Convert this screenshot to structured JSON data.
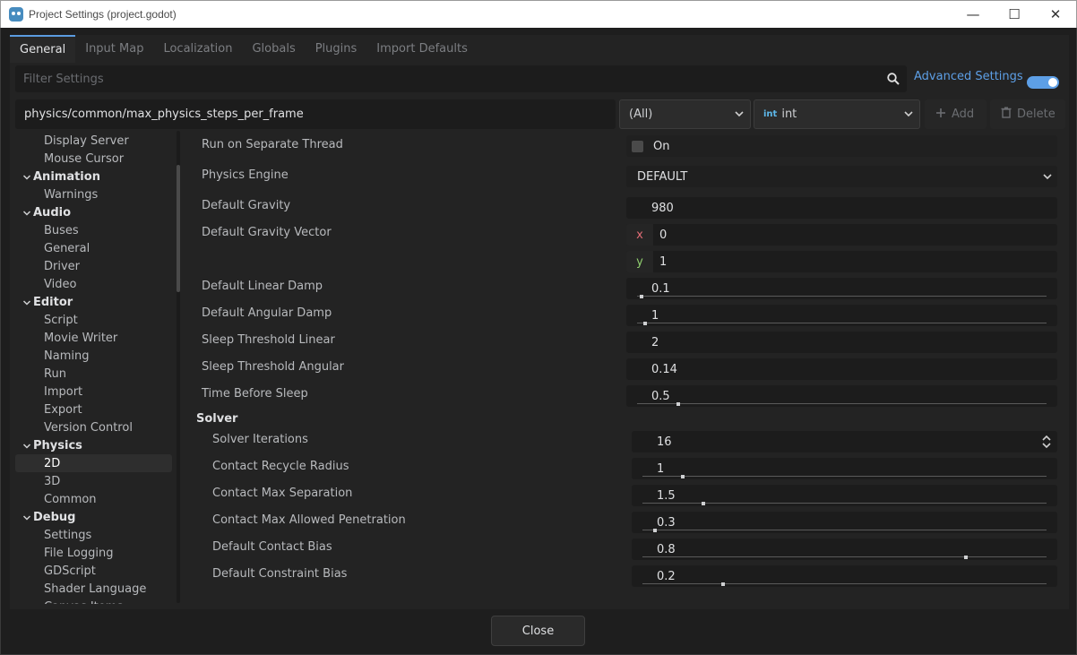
{
  "window": {
    "title": "Project Settings (project.godot)"
  },
  "tabs": [
    "General",
    "Input Map",
    "Localization",
    "Globals",
    "Plugins",
    "Import Defaults"
  ],
  "search": {
    "placeholder": "Filter Settings",
    "advanced_label": "Advanced Settings",
    "advanced_enabled": true
  },
  "path_bar": {
    "path": "physics/common/max_physics_steps_per_frame",
    "filter_value": "(All)",
    "type_icon": "int",
    "type_value": "int",
    "add_label": "Add",
    "delete_label": "Delete"
  },
  "tree": [
    {
      "label": "Display Server",
      "kind": "item"
    },
    {
      "label": "Mouse Cursor",
      "kind": "item"
    },
    {
      "label": "Animation",
      "kind": "cat"
    },
    {
      "label": "Warnings",
      "kind": "item"
    },
    {
      "label": "Audio",
      "kind": "cat"
    },
    {
      "label": "Buses",
      "kind": "item"
    },
    {
      "label": "General",
      "kind": "item"
    },
    {
      "label": "Driver",
      "kind": "item"
    },
    {
      "label": "Video",
      "kind": "item"
    },
    {
      "label": "Editor",
      "kind": "cat"
    },
    {
      "label": "Script",
      "kind": "item"
    },
    {
      "label": "Movie Writer",
      "kind": "item"
    },
    {
      "label": "Naming",
      "kind": "item"
    },
    {
      "label": "Run",
      "kind": "item"
    },
    {
      "label": "Import",
      "kind": "item"
    },
    {
      "label": "Export",
      "kind": "item"
    },
    {
      "label": "Version Control",
      "kind": "item"
    },
    {
      "label": "Physics",
      "kind": "cat"
    },
    {
      "label": "2D",
      "kind": "item",
      "selected": true
    },
    {
      "label": "3D",
      "kind": "item"
    },
    {
      "label": "Common",
      "kind": "item"
    },
    {
      "label": "Debug",
      "kind": "cat"
    },
    {
      "label": "Settings",
      "kind": "item"
    },
    {
      "label": "File Logging",
      "kind": "item"
    },
    {
      "label": "GDScript",
      "kind": "item"
    },
    {
      "label": "Shader Language",
      "kind": "item"
    },
    {
      "label": "Canvas Items",
      "kind": "item"
    }
  ],
  "properties": {
    "run_on_separate_thread": {
      "label": "Run on Separate Thread",
      "value": "On",
      "checked": false
    },
    "physics_engine": {
      "label": "Physics Engine",
      "value": "DEFAULT"
    },
    "default_gravity": {
      "label": "Default Gravity",
      "value": "980"
    },
    "default_gravity_vector": {
      "label": "Default Gravity Vector",
      "x_label": "x",
      "x": "0",
      "y_label": "y",
      "y": "1"
    },
    "default_linear_damp": {
      "label": "Default Linear Damp",
      "value": "0.1",
      "slider_fraction": 0.01
    },
    "default_angular_damp": {
      "label": "Default Angular Damp",
      "value": "1",
      "slider_fraction": 0.02
    },
    "sleep_threshold_linear": {
      "label": "Sleep Threshold Linear",
      "value": "2"
    },
    "sleep_threshold_angular": {
      "label": "Sleep Threshold Angular",
      "value": "0.14"
    },
    "time_before_sleep": {
      "label": "Time Before Sleep",
      "value": "0.5",
      "slider_fraction": 0.1
    }
  },
  "solver": {
    "title": "Solver",
    "solver_iterations": {
      "label": "Solver Iterations",
      "value": "16"
    },
    "contact_recycle_radius": {
      "label": "Contact Recycle Radius",
      "value": "1",
      "slider_fraction": 0.1
    },
    "contact_max_separation": {
      "label": "Contact Max Separation",
      "value": "1.5",
      "slider_fraction": 0.15
    },
    "contact_max_allowed_penetration": {
      "label": "Contact Max Allowed Penetration",
      "value": "0.3",
      "slider_fraction": 0.03
    },
    "default_contact_bias": {
      "label": "Default Contact Bias",
      "value": "0.8",
      "slider_fraction": 0.8
    },
    "default_constraint_bias": {
      "label": "Default Constraint Bias",
      "value": "0.2",
      "slider_fraction": 0.2
    }
  },
  "footer": {
    "close_label": "Close"
  }
}
